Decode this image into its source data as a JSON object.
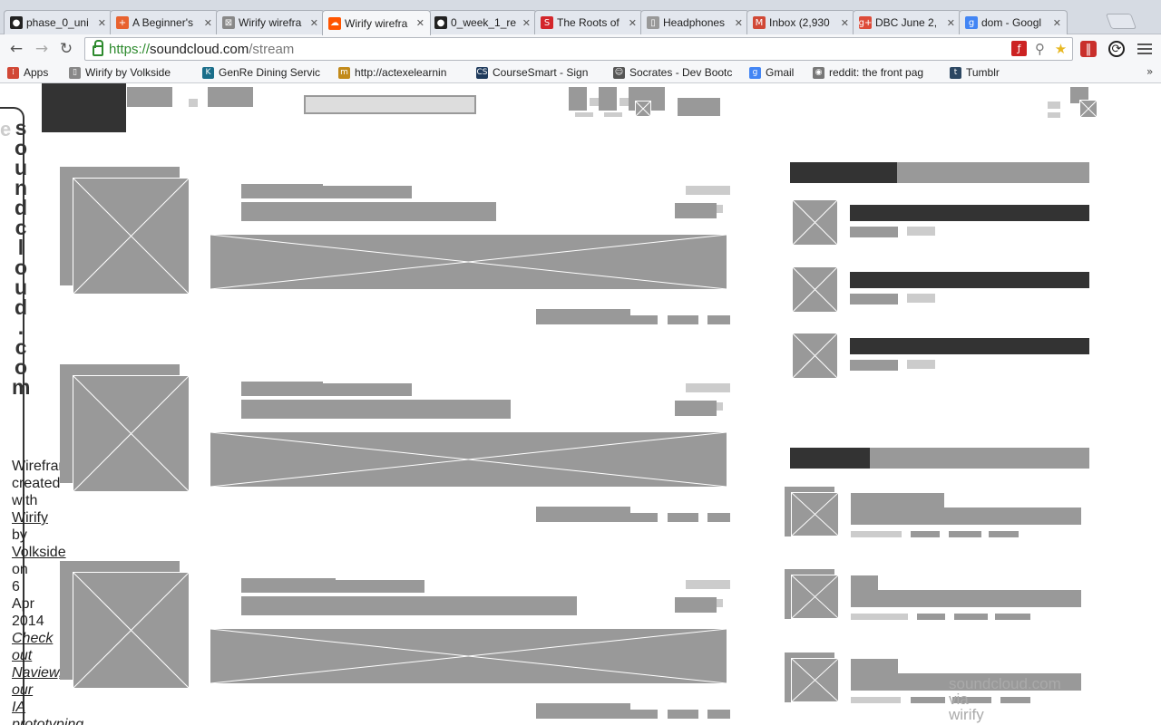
{
  "browser": {
    "tabs": [
      {
        "title": "phase_0_uni",
        "icon": "github-icon",
        "color": "#222222",
        "active": false
      },
      {
        "title": "A Beginner's",
        "icon": "plus-icon",
        "color": "#e8622f",
        "active": false
      },
      {
        "title": "Wirify wirefra",
        "icon": "placeholder-icon",
        "color": "#888888",
        "active": false
      },
      {
        "title": "Wirify wirefra",
        "icon": "soundcloud-icon",
        "color": "#ff5500",
        "active": true
      },
      {
        "title": "0_week_1_re",
        "icon": "github-icon",
        "color": "#222222",
        "active": false
      },
      {
        "title": "The Roots of",
        "icon": "s-icon",
        "color": "#d3262b",
        "active": false
      },
      {
        "title": "Headphones",
        "icon": "page-icon",
        "color": "#999999",
        "active": false
      },
      {
        "title": "Inbox (2,930",
        "icon": "gmail-icon",
        "color": "#d14836",
        "active": false
      },
      {
        "title": "DBC June 2,",
        "icon": "google-plus-icon",
        "color": "#dd4b39",
        "active": false
      },
      {
        "title": "dom - Googl",
        "icon": "google-icon",
        "color": "#4285f4",
        "active": false
      }
    ],
    "url": {
      "scheme": "https://",
      "host": "soundcloud.com",
      "path": "/stream"
    },
    "bookmarks": [
      {
        "label": "Apps",
        "icon": "apps-icon",
        "color": "#d14836"
      },
      {
        "label": "Wirify by Volkside",
        "icon": "page-icon",
        "color": "#888888"
      },
      {
        "label": "GenRe Dining Servic",
        "icon": "k-icon",
        "color": "#1a6e8a"
      },
      {
        "label": "http://actexelearnin",
        "icon": "m-icon",
        "color": "#c28a1a"
      },
      {
        "label": "CourseSmart - Sign",
        "icon": "cs-icon",
        "color": "#1e3a5c"
      },
      {
        "label": "Socrates - Dev Bootc",
        "icon": "socrates-icon",
        "color": "#555555"
      },
      {
        "label": "Gmail",
        "icon": "google-icon",
        "color": "#4285f4"
      },
      {
        "label": "reddit: the front pag",
        "icon": "reddit-icon",
        "color": "#777777"
      },
      {
        "label": "Tumblr",
        "icon": "tumblr-icon",
        "color": "#2c4762"
      }
    ],
    "bookmarks_more": "»"
  },
  "wireframe": {
    "side_title": "soundcloud.com",
    "credit": {
      "line1": "Wireframe",
      "line2": "created",
      "line3": "with",
      "wirify": "Wirify",
      "by": "by",
      "volkside": "Volkside",
      "on": "on",
      "day": "6",
      "month": "Apr",
      "year": "2014",
      "checkout1": "Check",
      "checkout2": "out",
      "checkout3": "Naview,",
      "checkout4": "our",
      "checkout5": "IA",
      "checkout6": "prototyping"
    },
    "watermark": {
      "line1": "soundcloud.com",
      "line2": "via",
      "line3": "wirify"
    }
  }
}
